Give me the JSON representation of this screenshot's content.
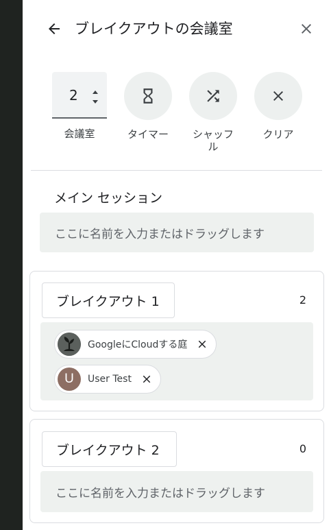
{
  "header": {
    "title": "ブレイクアウトの会議室"
  },
  "controls": {
    "room_count": {
      "value": "2",
      "label": "会議室"
    },
    "timer": {
      "label": "タイマー"
    },
    "shuffle": {
      "label_line1": "シャッフ",
      "label_line2": "ル"
    },
    "clear": {
      "label": "クリア"
    }
  },
  "main_session": {
    "title": "メイン セッション",
    "placeholder": "ここに名前を入力またはドラッグします"
  },
  "rooms": [
    {
      "name": "ブレイクアウト 1",
      "count": "2",
      "participants": [
        {
          "name": "GoogleにCloudする庭",
          "avatar_type": "image-plant-icon"
        },
        {
          "name": "User Test",
          "avatar_letter": "U",
          "avatar_color": "#8d6e63"
        }
      ]
    },
    {
      "name": "ブレイクアウト 2",
      "count": "0",
      "placeholder": "ここに名前を入力またはドラッグします"
    }
  ],
  "colors": {
    "sidebar_dark": "#1f2320",
    "control_button_bg": "#edf0ef",
    "drop_zone_bg": "#eef1ef",
    "text_primary": "#202124"
  }
}
